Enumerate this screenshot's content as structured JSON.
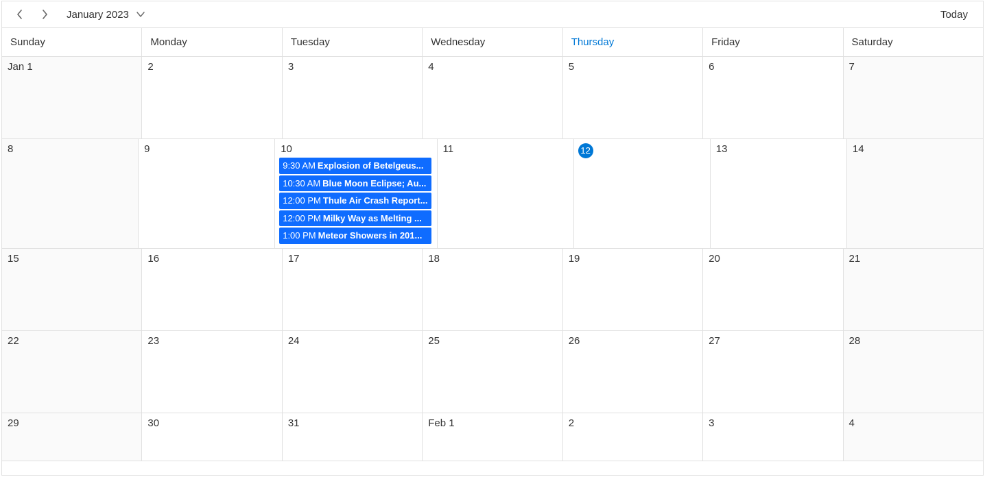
{
  "header": {
    "title": "January 2023",
    "today_label": "Today"
  },
  "days_of_week": [
    "Sunday",
    "Monday",
    "Tuesday",
    "Wednesday",
    "Thursday",
    "Friday",
    "Saturday"
  ],
  "today_weekday_index": 4,
  "today_date": 12,
  "weeks": [
    {
      "days": [
        {
          "label": "Jan 1",
          "work": false
        },
        {
          "label": "2",
          "work": true
        },
        {
          "label": "3",
          "work": true
        },
        {
          "label": "4",
          "work": true
        },
        {
          "label": "5",
          "work": true
        },
        {
          "label": "6",
          "work": true
        },
        {
          "label": "7",
          "work": false
        }
      ]
    },
    {
      "days": [
        {
          "label": "8",
          "work": false
        },
        {
          "label": "9",
          "work": true
        },
        {
          "label": "10",
          "work": true,
          "events": [
            {
              "time": "9:30 AM",
              "title": "Explosion of Betelgeus..."
            },
            {
              "time": "10:30 AM",
              "title": "Blue Moon Eclipse; Au..."
            },
            {
              "time": "12:00 PM",
              "title": "Thule Air Crash Report..."
            },
            {
              "time": "12:00 PM",
              "title": "Milky Way as Melting ..."
            },
            {
              "time": "1:00 PM",
              "title": "Meteor Showers in 201..."
            }
          ]
        },
        {
          "label": "11",
          "work": true
        },
        {
          "label": "12",
          "work": true,
          "is_today": true
        },
        {
          "label": "13",
          "work": true
        },
        {
          "label": "14",
          "work": false
        }
      ]
    },
    {
      "days": [
        {
          "label": "15",
          "work": false
        },
        {
          "label": "16",
          "work": true
        },
        {
          "label": "17",
          "work": true
        },
        {
          "label": "18",
          "work": true
        },
        {
          "label": "19",
          "work": true
        },
        {
          "label": "20",
          "work": true
        },
        {
          "label": "21",
          "work": false
        }
      ]
    },
    {
      "days": [
        {
          "label": "22",
          "work": false
        },
        {
          "label": "23",
          "work": true
        },
        {
          "label": "24",
          "work": true
        },
        {
          "label": "25",
          "work": true
        },
        {
          "label": "26",
          "work": true
        },
        {
          "label": "27",
          "work": true
        },
        {
          "label": "28",
          "work": false
        }
      ]
    },
    {
      "short": true,
      "days": [
        {
          "label": "29",
          "work": false
        },
        {
          "label": "30",
          "work": true
        },
        {
          "label": "31",
          "work": true
        },
        {
          "label": "Feb 1",
          "work": true
        },
        {
          "label": "2",
          "work": true
        },
        {
          "label": "3",
          "work": true
        },
        {
          "label": "4",
          "work": false
        }
      ]
    }
  ],
  "colors": {
    "accent": "#0078d6",
    "event_bg": "#0f6cff"
  }
}
